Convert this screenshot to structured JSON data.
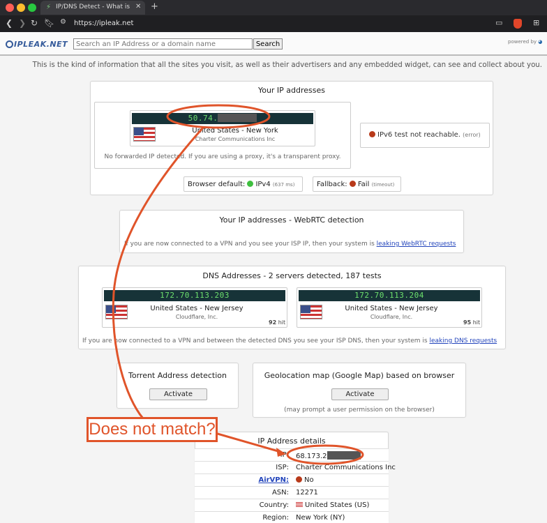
{
  "browser": {
    "tab_title": "IP/DNS Detect - What is your I",
    "url": "https://ipleak.net",
    "new_tab_icon": "plus-icon"
  },
  "header": {
    "logo": "IPLEAK.NET",
    "search_placeholder": "Search an IP Address or a domain name",
    "search_button": "Search",
    "powered_by": "powered by"
  },
  "intro": "This is the kind of information that all the sites you visit, as well as their advertisers and any embedded widget, can see and collect about you.",
  "ip_panel": {
    "title": "Your IP addresses",
    "ip": "50.74.",
    "location": "United States - New York",
    "isp": "Charter Communications Inc",
    "note": "No forwarded IP detected. If you are using a proxy, it's a transparent proxy.",
    "ipv6": "IPv6 test not reachable.",
    "ipv6_status": "(error)",
    "browser_default_label": "Browser default:",
    "browser_default_value": "IPv4",
    "browser_default_ms": "(637 ms)",
    "fallback_label": "Fallback:",
    "fallback_value": "Fail",
    "fallback_status": "(timeout)"
  },
  "webrtc": {
    "title": "Your IP addresses - WebRTC detection",
    "note": "If you are now connected to a VPN and you see your ISP IP, then your system is",
    "link": "leaking WebRTC requests"
  },
  "dns": {
    "title": "DNS Addresses - 2 servers detected, 187 tests",
    "servers": [
      {
        "ip": "172.70.113.203",
        "location": "United States - New Jersey",
        "isp": "Cloudflare, Inc.",
        "hits": "92",
        "hit_label": "hit"
      },
      {
        "ip": "172.70.113.204",
        "location": "United States - New Jersey",
        "isp": "Cloudflare, Inc.",
        "hits": "95",
        "hit_label": "hit"
      }
    ],
    "note": "If you are now connected to a VPN and between the detected DNS you see your ISP DNS, then your system is",
    "link": "leaking DNS requests"
  },
  "torrent": {
    "title": "Torrent Address detection",
    "button": "Activate"
  },
  "geo": {
    "title": "Geolocation map (Google Map) based on browser",
    "button": "Activate",
    "note": "(may prompt a user permission on the browser)"
  },
  "details": {
    "title": "IP Address details",
    "rows": [
      {
        "key": "IP:",
        "value": "68.173.2"
      },
      {
        "key": "ISP:",
        "value": "Charter Communications Inc"
      },
      {
        "key": "AirVPN:",
        "value": "No"
      },
      {
        "key": "ASN:",
        "value": "12271"
      },
      {
        "key": "Country:",
        "value": "United States (US)"
      },
      {
        "key": "Region:",
        "value": "New York (NY)"
      }
    ]
  },
  "annotation": {
    "label": "Does not match?",
    "color": "#e0542a"
  },
  "colors": {
    "green_dot": "#3fbf3f",
    "red_dot": "#b83a1a",
    "ip_bar_bg": "#173338",
    "ip_bar_text": "#6de06d"
  }
}
